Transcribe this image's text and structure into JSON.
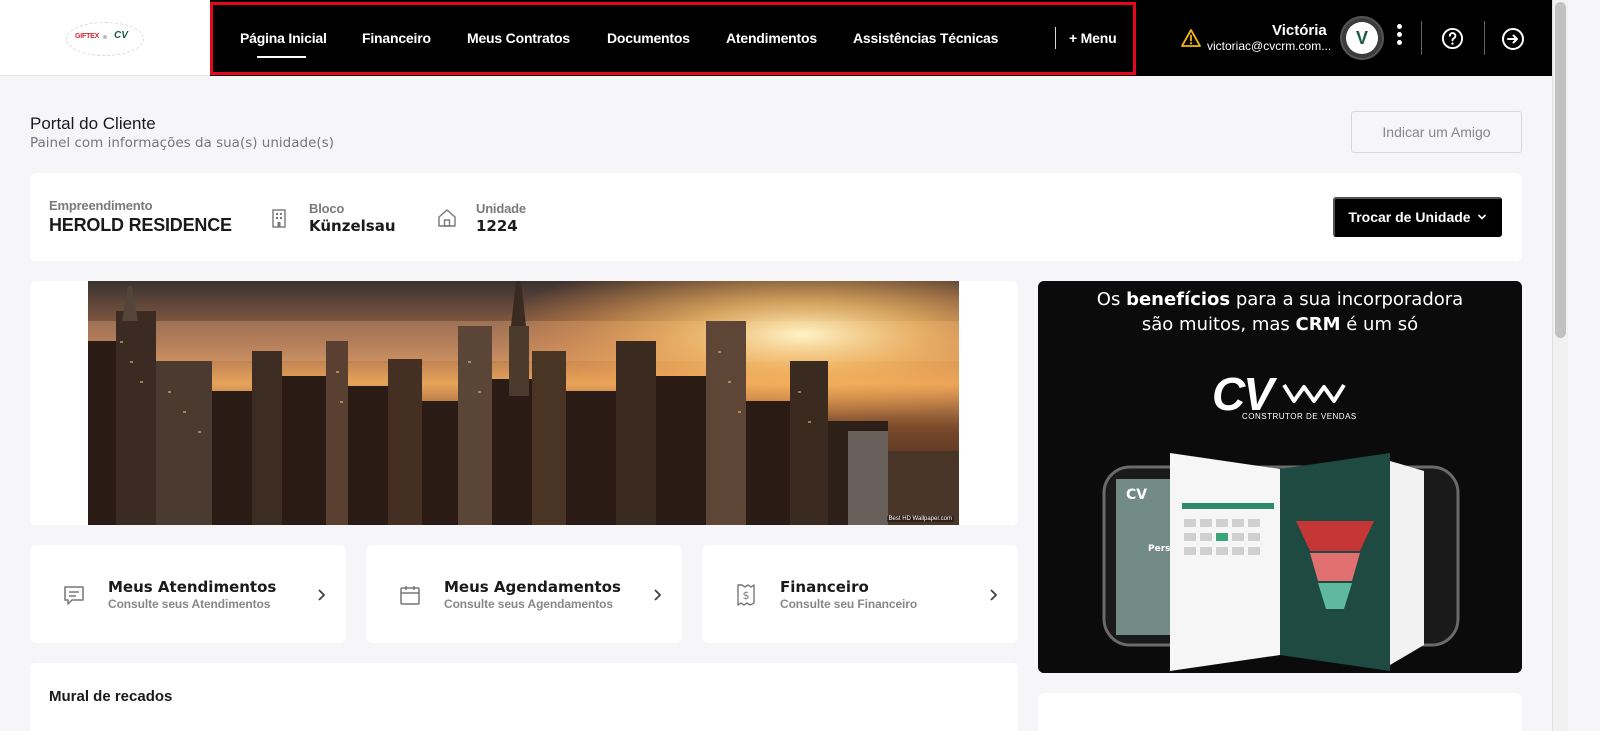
{
  "header": {
    "logo_left_text": "GIFTEX",
    "logo_right_text": "CV",
    "nav": [
      {
        "label": "Página Inicial",
        "active": true
      },
      {
        "label": "Financeiro"
      },
      {
        "label": "Meus Contratos"
      },
      {
        "label": "Documentos"
      },
      {
        "label": "Atendimentos"
      },
      {
        "label": "Assistências Técnicas"
      }
    ],
    "more_menu": "+ Menu",
    "user": {
      "name": "Victória",
      "email": "victoriac@cvcrm.com...",
      "avatar_letter": "V"
    },
    "icons": [
      "warning-icon",
      "kebab-icon",
      "help-icon",
      "logout-icon"
    ]
  },
  "page": {
    "title": "Portal do Cliente",
    "subtitle": "Painel com informações da sua(s) unidade(s)",
    "indicate_button": "Indicar um Amigo"
  },
  "unit": {
    "empreendimento_label": "Empreendimento",
    "empreendimento_value": "HEROLD RESIDENCE",
    "bloco_label": "Bloco",
    "bloco_value": "Künzelsau",
    "unidade_label": "Unidade",
    "unidade_value": "1224",
    "change_button": "Trocar de Unidade"
  },
  "banner": {
    "watermark": "Best HD Wallpaper.com"
  },
  "shortcuts": [
    {
      "title": "Meus Atendimentos",
      "subtitle": "Consulte seus Atendimentos",
      "icon": "chat-icon"
    },
    {
      "title": "Meus Agendamentos",
      "subtitle": "Consulte seus Agendamentos",
      "icon": "calendar-icon"
    },
    {
      "title": "Financeiro",
      "subtitle": "Consulte seu Financeiro",
      "icon": "receipt-icon"
    }
  ],
  "mural": {
    "title": "Mural de recados"
  },
  "ad": {
    "line1_pre": "Os ",
    "line1_bold": "benefícios",
    "line1_post": " para a sua incorporadora",
    "line2_pre": "são muitos, mas ",
    "line2_bold": "CRM",
    "line2_post": " é um só",
    "logo_text": "CV",
    "logo_sub": "CONSTRUTOR DE VENDAS"
  },
  "colors": {
    "topbar_bg": "#000000",
    "nav_highlight_border": "#e8061c",
    "brand_green": "#1a5b4a",
    "warning": "#f5b50a"
  }
}
